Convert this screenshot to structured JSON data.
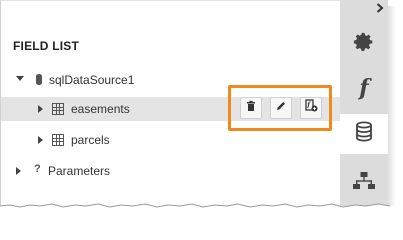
{
  "panel": {
    "title": "FIELD LIST"
  },
  "tree": [
    {
      "label": "sqlDataSource1",
      "icon": "database-icon",
      "expanded": true
    },
    {
      "label": "easements",
      "icon": "table-icon",
      "expanded": false,
      "selected": true
    },
    {
      "label": "parcels",
      "icon": "table-icon",
      "expanded": false
    },
    {
      "label": "Parameters",
      "icon": "question-icon",
      "expanded": false
    }
  ],
  "row_actions": [
    {
      "icon": "trash-icon"
    },
    {
      "icon": "pencil-icon"
    },
    {
      "icon": "calculated-field-icon"
    }
  ],
  "sidebar": [
    {
      "icon": "gear-icon",
      "active": false
    },
    {
      "icon": "function-icon",
      "glyph": "f",
      "active": false
    },
    {
      "icon": "database-icon",
      "active": true
    },
    {
      "icon": "hierarchy-icon",
      "active": false
    }
  ],
  "colors": {
    "highlight": "#f08a1c",
    "selected_row": "#e4e4e4",
    "sidebar": "#dcdcdc",
    "icon": "#444444"
  }
}
